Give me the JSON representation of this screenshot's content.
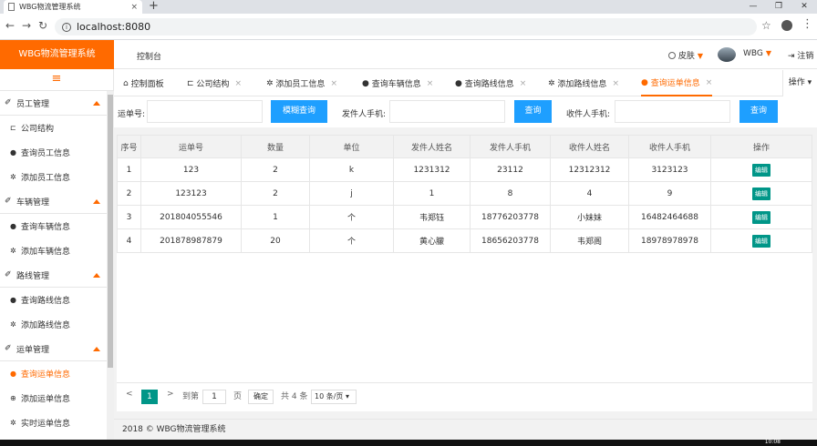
{
  "browser": {
    "tab_title": "WBG物流管理系统",
    "tab_close": "×",
    "new_tab": "+",
    "url": "localhost:8080"
  },
  "header": {
    "logo": "WBG物流管理系统",
    "nav": "控制台",
    "skin": "皮肤",
    "user": "WBG",
    "logout": "注销"
  },
  "sidebar": {
    "groups": [
      {
        "label": "员工管理",
        "items": [
          {
            "label": "公司结构"
          },
          {
            "label": "查询员工信息"
          },
          {
            "label": "添加员工信息"
          }
        ]
      },
      {
        "label": "车辆管理",
        "items": [
          {
            "label": "查询车辆信息"
          },
          {
            "label": "添加车辆信息"
          }
        ]
      },
      {
        "label": "路线管理",
        "items": [
          {
            "label": "查询路线信息"
          },
          {
            "label": "添加路线信息"
          }
        ]
      },
      {
        "label": "运单管理",
        "items": [
          {
            "label": "查询运单信息"
          },
          {
            "label": "添加运单信息"
          },
          {
            "label": "实时运单信息"
          }
        ]
      }
    ]
  },
  "tabs": {
    "items": [
      {
        "label": "控制面板"
      },
      {
        "label": "公司结构"
      },
      {
        "label": "添加员工信息"
      },
      {
        "label": "查询车辆信息"
      },
      {
        "label": "查询路线信息"
      },
      {
        "label": "添加路线信息"
      },
      {
        "label": "查询运单信息"
      }
    ],
    "close": "×",
    "operations": "操作"
  },
  "search": {
    "waybill_label": "运单号:",
    "fuzzy_button": "模糊查询",
    "sender_phone_label": "发件人手机:",
    "query_button": "查询",
    "receiver_phone_label": "收件人手机:",
    "query_button2": "查询"
  },
  "table": {
    "headers": [
      "序号",
      "运单号",
      "数量",
      "单位",
      "发件人姓名",
      "发件人手机",
      "收件人姓名",
      "收件人手机",
      "操作"
    ],
    "rows": [
      [
        "1",
        "123",
        "2",
        "k",
        "1231312",
        "23112",
        "12312312",
        "3123123"
      ],
      [
        "2",
        "123123",
        "2",
        "j",
        "1",
        "8",
        "4",
        "9"
      ],
      [
        "3",
        "201804055546",
        "1",
        "个",
        "韦郑钰",
        "18776203778",
        "小妹妹",
        "16482464688"
      ],
      [
        "4",
        "201878987879",
        "20",
        "个",
        "黄心朦",
        "18656203778",
        "韦郑阁",
        "18978978978"
      ]
    ],
    "edit_label": "编辑"
  },
  "pager": {
    "prev": "<",
    "current": "1",
    "next": ">",
    "goto": "到第",
    "page_input": "1",
    "page_unit": "页",
    "confirm": "确定",
    "total": "共 4 条",
    "page_size": "10 条/页 ▾"
  },
  "footer": {
    "text": "2018 © WBG物流管理系统"
  },
  "taskbar": {
    "clock": "10:08"
  },
  "colors": {
    "brand": "#ff6a00",
    "primary_button": "#1e9fff",
    "edit_button": "#009688"
  }
}
